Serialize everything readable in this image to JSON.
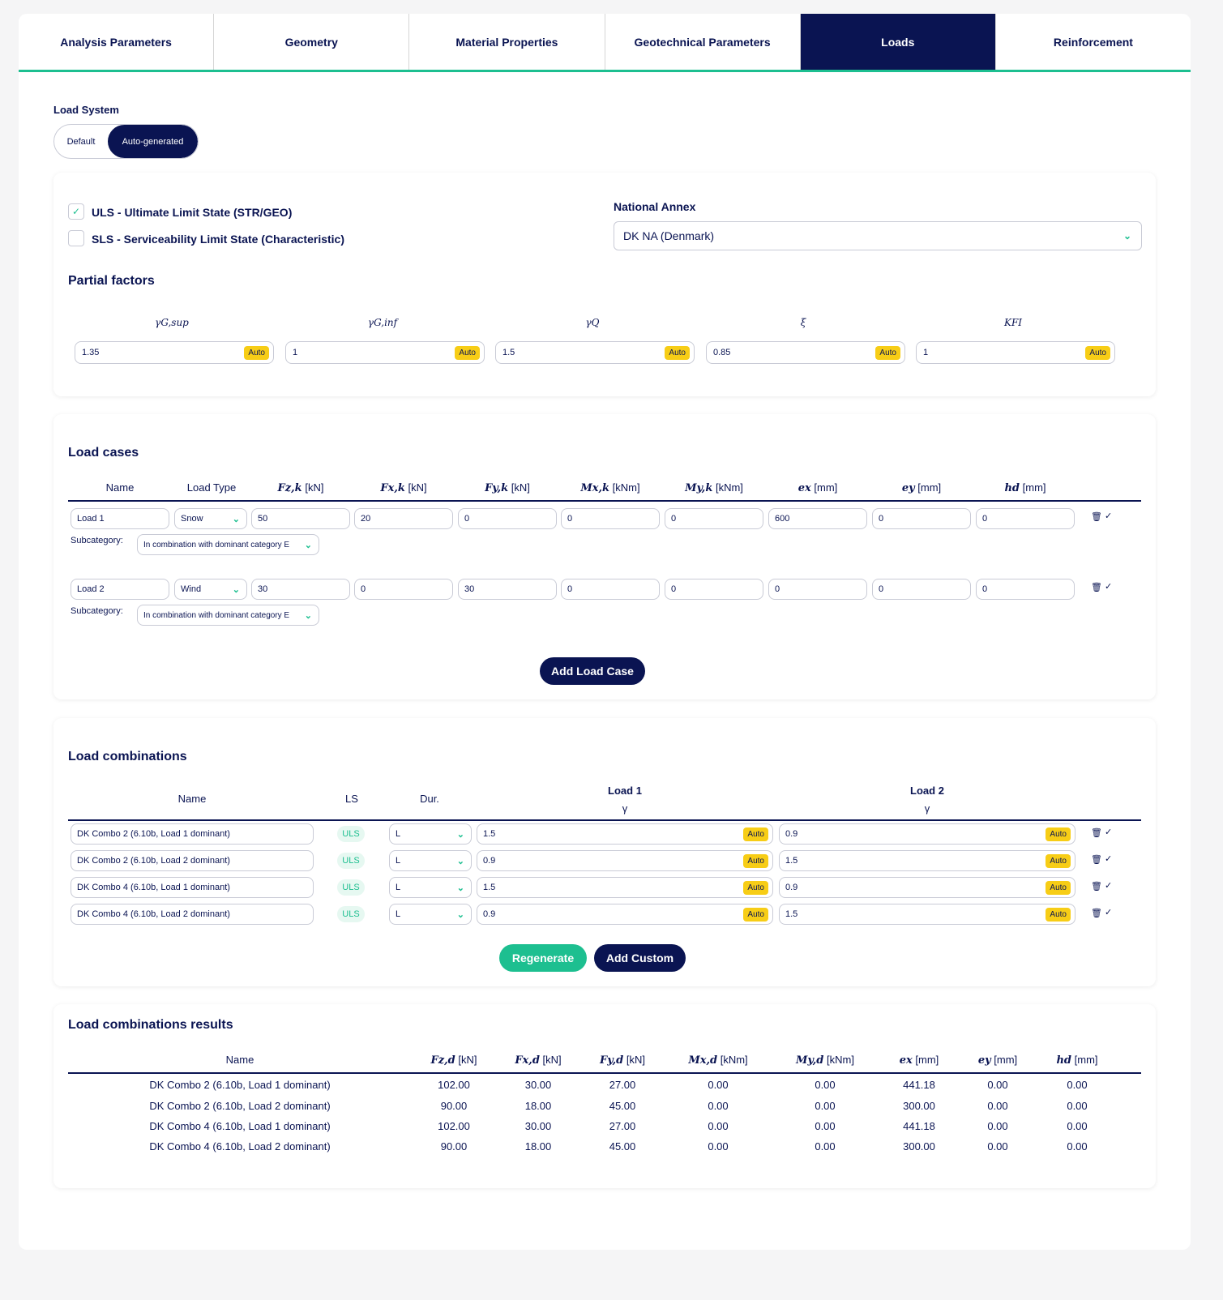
{
  "tabs": [
    {
      "label": "Analysis Parameters",
      "active": false
    },
    {
      "label": "Geometry",
      "active": false
    },
    {
      "label": "Material Properties",
      "active": false
    },
    {
      "label": "Geotechnical Parameters",
      "active": false
    },
    {
      "label": "Loads",
      "active": true
    },
    {
      "label": "Reinforcement",
      "active": false
    }
  ],
  "load_system": {
    "label": "Load System",
    "options": [
      "Default",
      "Auto-generated"
    ],
    "selected": "Auto-generated"
  },
  "limit_states": {
    "uls": {
      "label": "ULS - Ultimate Limit State (STR/GEO)",
      "checked": true
    },
    "sls": {
      "label": "SLS - Serviceability Limit State (Characteristic)",
      "checked": false
    }
  },
  "national_annex": {
    "label": "National Annex",
    "value": "DK NA (Denmark)"
  },
  "partial_factors": {
    "title": "Partial factors",
    "auto_label": "Auto",
    "items": [
      {
        "symbol": "γG,sup",
        "value": "1.35"
      },
      {
        "symbol": "γG,inf",
        "value": "1"
      },
      {
        "symbol": "γQ",
        "value": "1.5"
      },
      {
        "symbol": "ξ",
        "value": "0.85"
      },
      {
        "symbol": "KFI",
        "value": "1"
      }
    ]
  },
  "load_cases": {
    "title": "Load cases",
    "headers": {
      "name": "Name",
      "load_type": "Load Type",
      "fz_sym": "Fz,k",
      "fz_unit": "[kN]",
      "fx_sym": "Fx,k",
      "fx_unit": "[kN]",
      "fy_sym": "Fy,k",
      "fy_unit": "[kN]",
      "mx_sym": "Mx,k",
      "mx_unit": "[kNm]",
      "my_sym": "My,k",
      "my_unit": "[kNm]",
      "ex_sym": "ex",
      "ex_unit": "[mm]",
      "ey_sym": "ey",
      "ey_unit": "[mm]",
      "hd_sym": "hd",
      "hd_unit": "[mm]"
    },
    "subcategory_label": "Subcategory:",
    "rows": [
      {
        "name": "Load 1",
        "type": "Snow",
        "fz": "50",
        "fx": "20",
        "fy": "0",
        "mx": "0",
        "my": "0",
        "ex": "600",
        "ey": "0",
        "hd": "0",
        "subcategory": "In combination with dominant category E"
      },
      {
        "name": "Load 2",
        "type": "Wind",
        "fz": "30",
        "fx": "0",
        "fy": "30",
        "mx": "0",
        "my": "0",
        "ex": "0",
        "ey": "0",
        "hd": "0",
        "subcategory": "In combination with dominant category E"
      }
    ],
    "add_button": "Add Load Case"
  },
  "load_combinations": {
    "title": "Load combinations",
    "headers": {
      "name": "Name",
      "ls": "LS",
      "dur": "Dur.",
      "load1": "Load 1",
      "load2": "Load 2",
      "gamma": "γ"
    },
    "auto_label": "Auto",
    "rows": [
      {
        "name": "DK Combo 2 (6.10b, Load 1 dominant)",
        "ls": "ULS",
        "dur": "L",
        "g1": "1.5",
        "g2": "0.9"
      },
      {
        "name": "DK Combo 2 (6.10b, Load 2 dominant)",
        "ls": "ULS",
        "dur": "L",
        "g1": "0.9",
        "g2": "1.5"
      },
      {
        "name": "DK Combo 4 (6.10b, Load 1 dominant)",
        "ls": "ULS",
        "dur": "L",
        "g1": "1.5",
        "g2": "0.9"
      },
      {
        "name": "DK Combo 4 (6.10b, Load 2 dominant)",
        "ls": "ULS",
        "dur": "L",
        "g1": "0.9",
        "g2": "1.5"
      }
    ],
    "regenerate_button": "Regenerate",
    "add_custom_button": "Add Custom"
  },
  "results": {
    "title": "Load combinations results",
    "headers": {
      "name": "Name",
      "fz_sym": "Fz,d",
      "fz_unit": "[kN]",
      "fx_sym": "Fx,d",
      "fx_unit": "[kN]",
      "fy_sym": "Fy,d",
      "fy_unit": "[kN]",
      "mx_sym": "Mx,d",
      "mx_unit": "[kNm]",
      "my_sym": "My,d",
      "my_unit": "[kNm]",
      "ex_sym": "ex",
      "ex_unit": "[mm]",
      "ey_sym": "ey",
      "ey_unit": "[mm]",
      "hd_sym": "hd",
      "hd_unit": "[mm]"
    },
    "rows": [
      {
        "name": "DK Combo 2 (6.10b, Load 1 dominant)",
        "fz": "102.00",
        "fx": "30.00",
        "fy": "27.00",
        "mx": "0.00",
        "my": "0.00",
        "ex": "441.18",
        "ey": "0.00",
        "hd": "0.00"
      },
      {
        "name": "DK Combo 2 (6.10b, Load 2 dominant)",
        "fz": "90.00",
        "fx": "18.00",
        "fy": "45.00",
        "mx": "0.00",
        "my": "0.00",
        "ex": "300.00",
        "ey": "0.00",
        "hd": "0.00"
      },
      {
        "name": "DK Combo 4 (6.10b, Load 1 dominant)",
        "fz": "102.00",
        "fx": "30.00",
        "fy": "27.00",
        "mx": "0.00",
        "my": "0.00",
        "ex": "441.18",
        "ey": "0.00",
        "hd": "0.00"
      },
      {
        "name": "DK Combo 4 (6.10b, Load 2 dominant)",
        "fz": "90.00",
        "fx": "18.00",
        "fy": "45.00",
        "mx": "0.00",
        "my": "0.00",
        "ex": "300.00",
        "ey": "0.00",
        "hd": "0.00"
      }
    ]
  },
  "colors": {
    "navy": "#0a1452",
    "green": "#1dbf90",
    "auto_yellow": "#f7cd16"
  }
}
